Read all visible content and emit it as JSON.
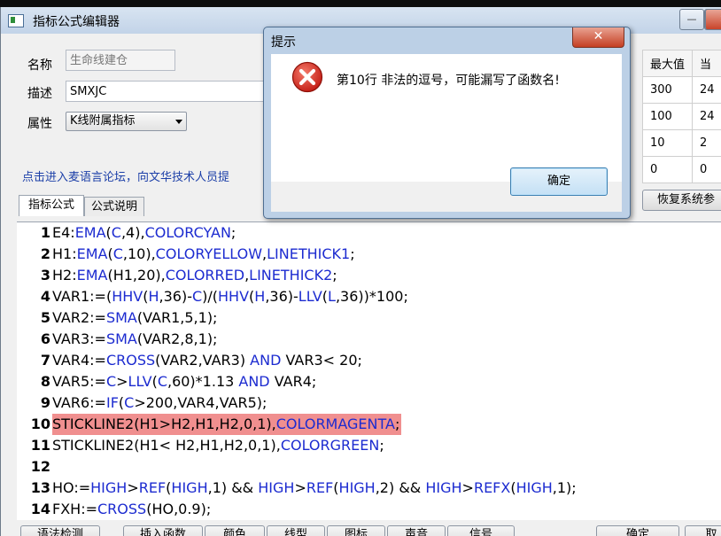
{
  "window": {
    "title": "指标公式编辑器",
    "minimize": "—",
    "maximize": "❐",
    "close": "✕"
  },
  "form": {
    "name_label": "名称",
    "name_value": "生命线建仓",
    "desc_label": "描述",
    "desc_value": "SMXJC",
    "attr_label": "属性",
    "attr_value": "K线附属指标"
  },
  "forum_link": "点击进入麦语言论坛，向文华技术人员提",
  "param_table": {
    "headers": [
      "最大值",
      "当"
    ],
    "rows": [
      [
        "300",
        "24"
      ],
      [
        "100",
        "24"
      ],
      [
        "10",
        "2"
      ],
      [
        "0",
        "0"
      ]
    ]
  },
  "restore_button": "恢复系统参",
  "tabs": [
    "指标公式",
    "公式说明"
  ],
  "code_lines": [
    {
      "num": "1",
      "segments": [
        [
          "E4:",
          0
        ],
        [
          "EMA",
          1
        ],
        [
          "(",
          0
        ],
        [
          "C",
          1
        ],
        [
          ",4),",
          0
        ],
        [
          "COLORCYAN",
          1
        ],
        [
          ";",
          0
        ]
      ]
    },
    {
      "num": "2",
      "segments": [
        [
          "H1:",
          0
        ],
        [
          "EMA",
          1
        ],
        [
          "(",
          0
        ],
        [
          "C",
          1
        ],
        [
          ",10),",
          0
        ],
        [
          "COLORYELLOW",
          1
        ],
        [
          ",",
          0
        ],
        [
          "LINETHICK1",
          1
        ],
        [
          ";",
          0
        ]
      ]
    },
    {
      "num": "3",
      "segments": [
        [
          "H2:",
          0
        ],
        [
          "EMA",
          1
        ],
        [
          "(H1,20),",
          0
        ],
        [
          "COLORRED",
          1
        ],
        [
          ",",
          0
        ],
        [
          "LINETHICK2",
          1
        ],
        [
          ";",
          0
        ]
      ]
    },
    {
      "num": "4",
      "segments": [
        [
          "VAR1:=(",
          0
        ],
        [
          "HHV",
          1
        ],
        [
          "(",
          0
        ],
        [
          "H",
          1
        ],
        [
          ",36)-",
          0
        ],
        [
          "C",
          1
        ],
        [
          ")/(",
          0
        ],
        [
          "HHV",
          1
        ],
        [
          "(",
          0
        ],
        [
          "H",
          1
        ],
        [
          ",36)-",
          0
        ],
        [
          "LLV",
          1
        ],
        [
          "(",
          0
        ],
        [
          "L",
          1
        ],
        [
          ",36))*100;",
          0
        ]
      ]
    },
    {
      "num": "5",
      "segments": [
        [
          "VAR2:=",
          0
        ],
        [
          "SMA",
          1
        ],
        [
          "(VAR1,5,1);",
          0
        ]
      ]
    },
    {
      "num": "6",
      "segments": [
        [
          "VAR3:=",
          0
        ],
        [
          "SMA",
          1
        ],
        [
          "(VAR2,8,1);",
          0
        ]
      ]
    },
    {
      "num": "7",
      "segments": [
        [
          "VAR4:=",
          0
        ],
        [
          "CROSS",
          1
        ],
        [
          "(VAR2,VAR3) ",
          0
        ],
        [
          "AND",
          1
        ],
        [
          " VAR3< 20;",
          0
        ]
      ]
    },
    {
      "num": "8",
      "segments": [
        [
          "VAR5:=",
          0
        ],
        [
          "C",
          1
        ],
        [
          ">",
          0
        ],
        [
          "LLV",
          1
        ],
        [
          "(",
          0
        ],
        [
          "C",
          1
        ],
        [
          ",60)*1.13 ",
          0
        ],
        [
          "AND",
          1
        ],
        [
          " VAR4;",
          0
        ]
      ]
    },
    {
      "num": "9",
      "segments": [
        [
          "VAR6:=",
          0
        ],
        [
          "IF",
          1
        ],
        [
          "(",
          0
        ],
        [
          "C",
          1
        ],
        [
          ">200,VAR4,VAR5);",
          0
        ]
      ]
    },
    {
      "num": "10",
      "highlight": true,
      "segments": [
        [
          "STICKLINE2(H1>H2,H1,H2,0,1),",
          0
        ],
        [
          "COLORMAGENTA",
          1
        ],
        [
          ";",
          0
        ]
      ]
    },
    {
      "num": "11",
      "segments": [
        [
          "STICKLINE2(H1< H2,H1,H2,0,1),",
          0
        ],
        [
          "COLORGREEN",
          1
        ],
        [
          ";",
          0
        ]
      ]
    },
    {
      "num": "12",
      "segments": []
    },
    {
      "num": "13",
      "segments": [
        [
          "HO:=",
          0
        ],
        [
          "HIGH",
          1
        ],
        [
          ">",
          0
        ],
        [
          "REF",
          1
        ],
        [
          "(",
          0
        ],
        [
          "HIGH",
          1
        ],
        [
          ",1) && ",
          0
        ],
        [
          "HIGH",
          1
        ],
        [
          ">",
          0
        ],
        [
          "REF",
          1
        ],
        [
          "(",
          0
        ],
        [
          "HIGH",
          1
        ],
        [
          ",2) && ",
          0
        ],
        [
          "HIGH",
          1
        ],
        [
          ">",
          0
        ],
        [
          "REFX",
          1
        ],
        [
          "(",
          0
        ],
        [
          "HIGH",
          1
        ],
        [
          ",1);",
          0
        ]
      ]
    },
    {
      "num": "14",
      "segments": [
        [
          "FXH:=",
          0
        ],
        [
          "CROSS",
          1
        ],
        [
          "(HO,0.9);",
          0
        ]
      ]
    }
  ],
  "bottom_buttons": [
    "语法检测",
    "插入函数",
    "颜色",
    "线型",
    "图标",
    "声音",
    "信号",
    "确定",
    "取"
  ],
  "dialog": {
    "title": "提示",
    "close": "✕",
    "message": "第10行 非法的逗号，可能漏写了函数名!",
    "ok_label": "确定"
  },
  "colors": {
    "keyword": "#1c2bd0",
    "highlight": "#f08f8f",
    "error_red": "#d42020"
  }
}
